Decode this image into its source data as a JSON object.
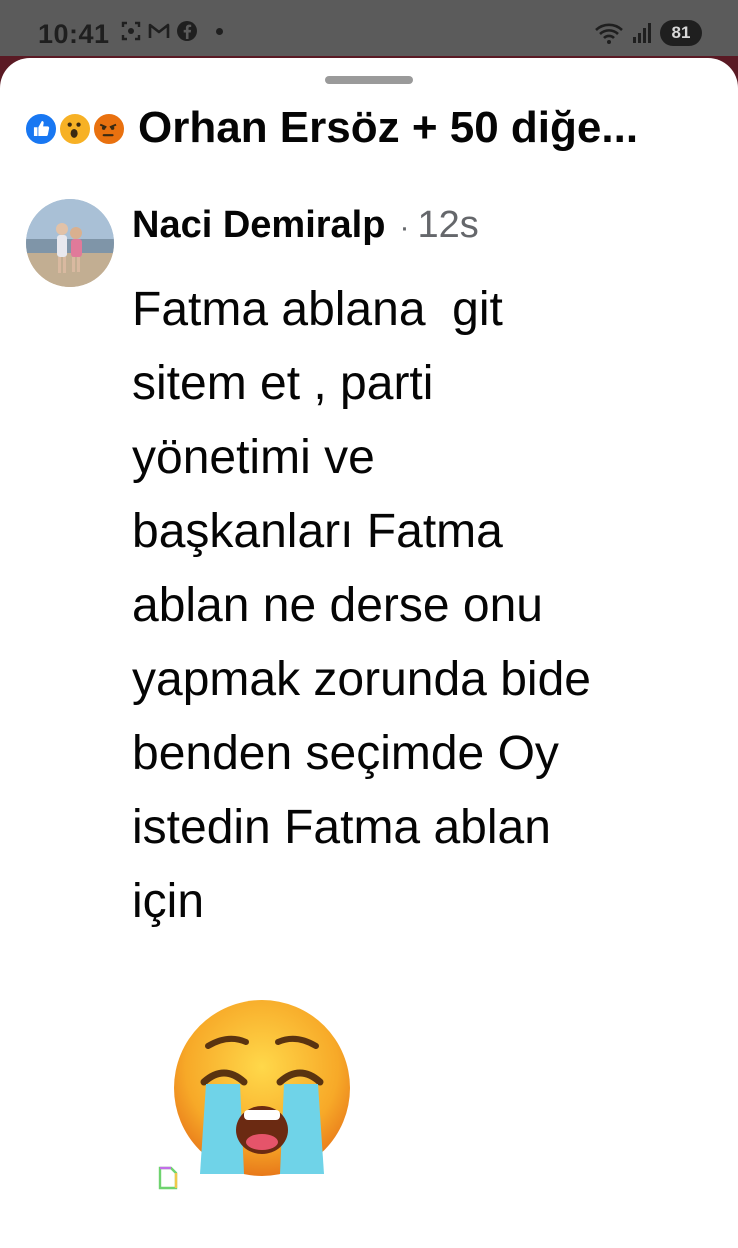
{
  "status_bar": {
    "time": "10:41",
    "battery": "81"
  },
  "reactions": {
    "icons": [
      "like-icon",
      "wow-icon",
      "angry-icon"
    ],
    "summary": "Orhan Ersöz + 50 diğe..."
  },
  "comment": {
    "author": "Naci Demiralp",
    "separator": "·",
    "time": "12s",
    "lines": [
      "Fatma ablana  git",
      "sitem et , parti",
      "yönetimi ve",
      "başkanları Fatma",
      "ablan ne derse onu",
      "yapmak zorunda bide",
      "benden seçimde Oy",
      "istedin Fatma ablan",
      "için"
    ],
    "sticker": "loudly-crying-face-emoji"
  },
  "colors": {
    "like_blue": "#1877f2",
    "text": "#050505",
    "secondary_text": "#65676b",
    "sheet_bg": "#ffffff"
  }
}
